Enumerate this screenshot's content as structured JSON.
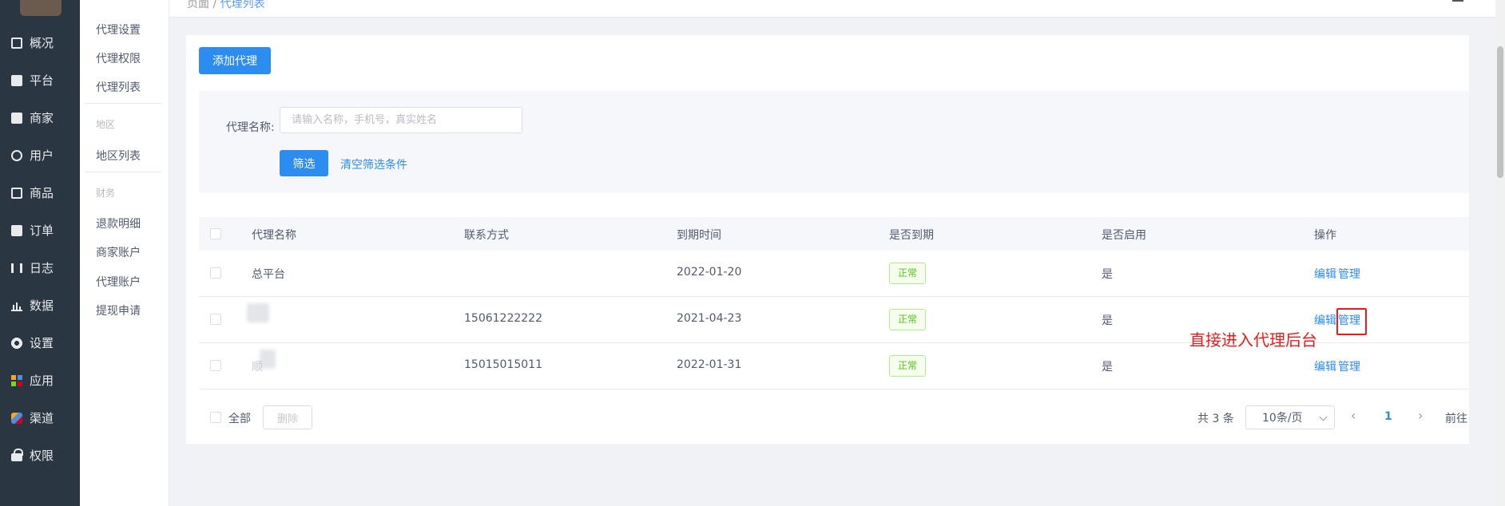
{
  "nav": {
    "items": [
      {
        "label": "概况",
        "icon": "monitor-icon"
      },
      {
        "label": "平台",
        "icon": "desktop-icon"
      },
      {
        "label": "商家",
        "icon": "store-icon"
      },
      {
        "label": "用户",
        "icon": "user-icon"
      },
      {
        "label": "商品",
        "icon": "goods-icon"
      },
      {
        "label": "订单",
        "icon": "order-icon"
      },
      {
        "label": "日志",
        "icon": "log-icon"
      },
      {
        "label": "数据",
        "icon": "chart-icon"
      },
      {
        "label": "设置",
        "icon": "gear-icon"
      },
      {
        "label": "应用",
        "icon": "apps-icon"
      },
      {
        "label": "渠道",
        "icon": "channel-icon"
      },
      {
        "label": "权限",
        "icon": "lock-icon"
      }
    ]
  },
  "submenu": {
    "agent_items": [
      "代理设置",
      "代理权限",
      "代理列表"
    ],
    "region_group": "地区",
    "region_items": [
      "地区列表"
    ],
    "finance_group": "财务",
    "finance_items": [
      "退款明细",
      "商家账户",
      "代理账户",
      "提现申请"
    ]
  },
  "header": {
    "crumb_home": "页面",
    "crumb_sep": " / ",
    "crumb_current": "代理列表"
  },
  "toolbar": {
    "add_label": "添加代理"
  },
  "filter": {
    "label": "代理名称:",
    "placeholder": "请输入名称，手机号，真实姓名",
    "submit_label": "筛选",
    "clear_label": "清空筛选条件"
  },
  "table": {
    "columns": [
      "代理名称",
      "联系方式",
      "到期时间",
      "是否到期",
      "是否启用",
      "操作"
    ],
    "rows": [
      {
        "name": "总平台",
        "contact": "",
        "expire": "2022-01-20",
        "status": "正常",
        "enabled": "是",
        "edit": "编辑",
        "manage": "管理"
      },
      {
        "name": "",
        "contact": "15061222222",
        "expire": "2021-04-23",
        "status": "正常",
        "enabled": "是",
        "edit": "编辑",
        "manage": "管理"
      },
      {
        "name": "顺",
        "contact": "15015015011",
        "expire": "2022-01-31",
        "status": "正常",
        "enabled": "是",
        "edit": "编辑",
        "manage": "管理"
      }
    ]
  },
  "annotation": {
    "text": "直接进入代理后台",
    "color": "#e02020"
  },
  "footer": {
    "select_all_label": "全部",
    "delete_label": "删除",
    "total_label": "共 3 条",
    "page_size": "10条/页",
    "prev_icon": "‹",
    "current_page": "1",
    "next_icon": "›",
    "goto_label": "前往"
  },
  "colors": {
    "nav_bg": "#2b3643",
    "primary": "#2d8cf0",
    "success": "#52c41a"
  }
}
